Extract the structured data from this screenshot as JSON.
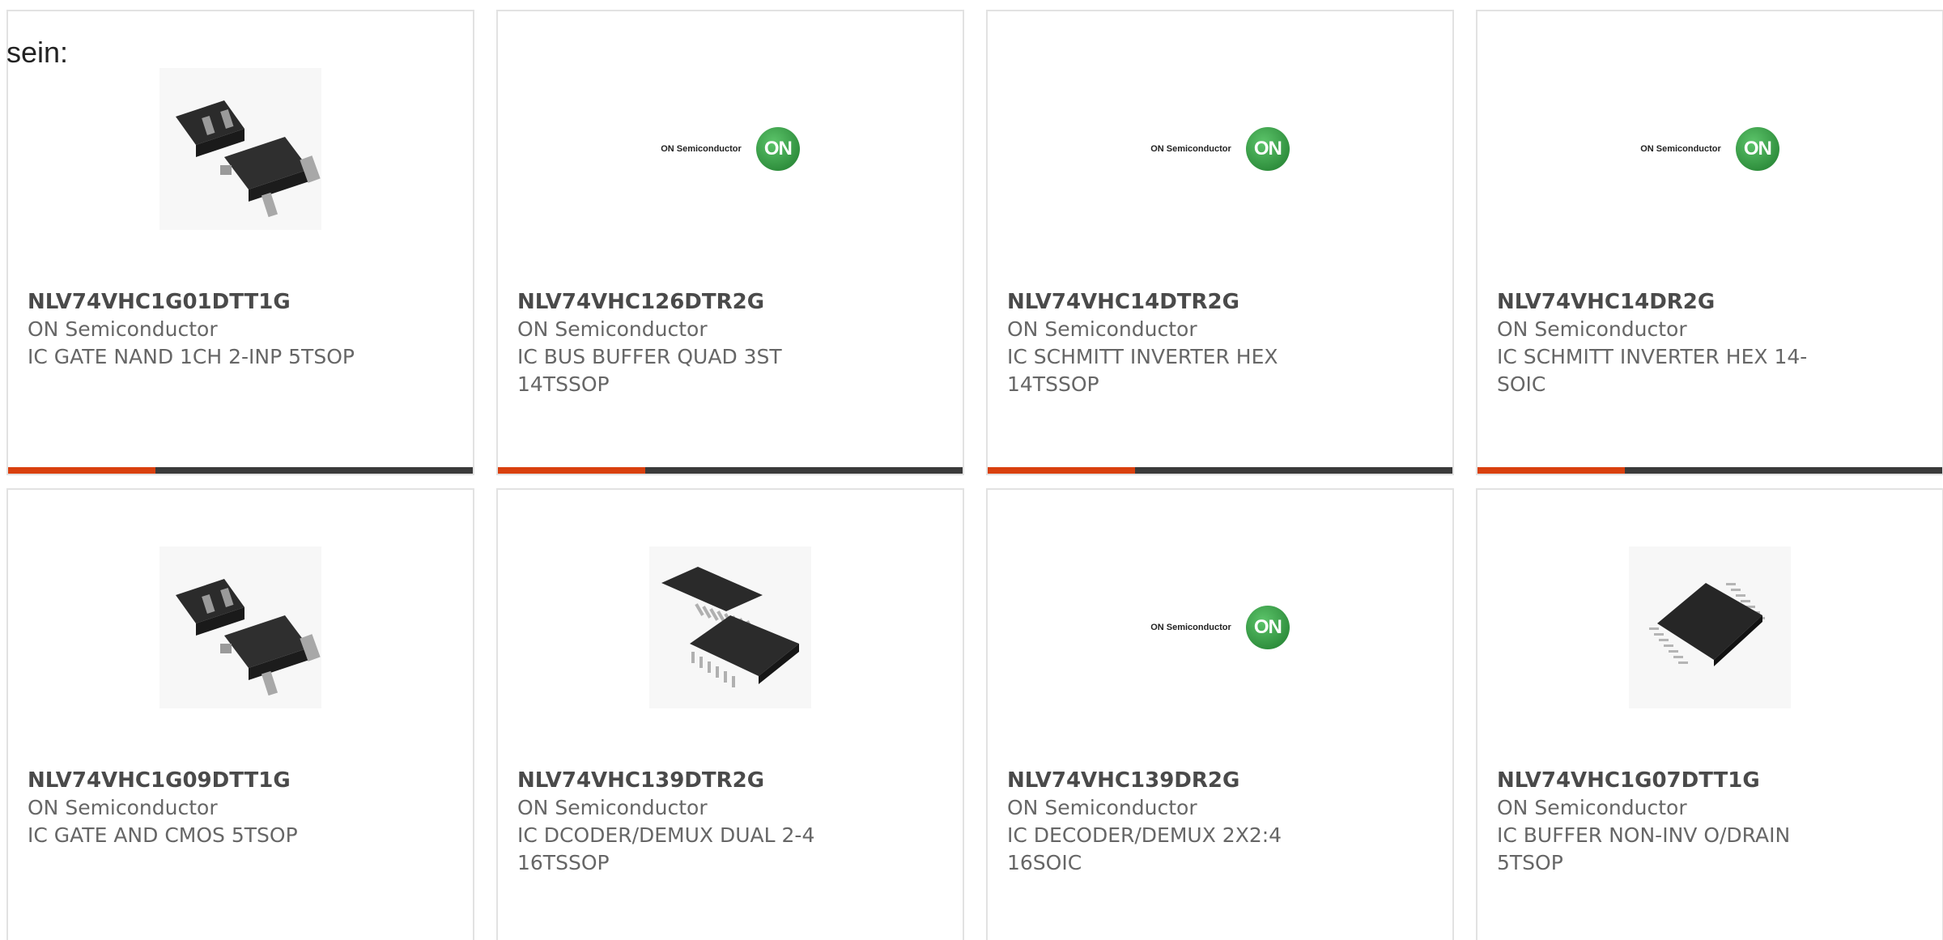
{
  "intro_text": "sein:",
  "colors": {
    "accent": "#d9400e",
    "bar": "#3a3a3a",
    "card_border": "#e2e2e2",
    "on_logo_green": "#2e8b3a"
  },
  "products": [
    {
      "part": "NLV74VHC1G01DTT1G",
      "manufacturer": "ON Semiconductor",
      "description": "IC GATE NAND 1CH 2-INP 5TSOP",
      "image": "sot-package-image",
      "show_bar": true
    },
    {
      "part": "NLV74VHC126DTR2G",
      "manufacturer": "ON Semiconductor",
      "description": "IC BUS BUFFER QUAD 3ST 14TSSOP",
      "image": "on-semiconductor-logo",
      "logo_text": "ON Semiconductor",
      "logo_mark": "ON",
      "show_bar": true
    },
    {
      "part": "NLV74VHC14DTR2G",
      "manufacturer": "ON Semiconductor",
      "description": "IC SCHMITT INVERTER HEX 14TSSOP",
      "image": "on-semiconductor-logo",
      "logo_text": "ON Semiconductor",
      "logo_mark": "ON",
      "show_bar": true
    },
    {
      "part": "NLV74VHC14DR2G",
      "manufacturer": "ON Semiconductor",
      "description": "IC SCHMITT INVERTER HEX 14-SOIC",
      "image": "on-semiconductor-logo",
      "logo_text": "ON Semiconductor",
      "logo_mark": "ON",
      "show_bar": true
    },
    {
      "part": "NLV74VHC1G09DTT1G",
      "manufacturer": "ON Semiconductor",
      "description": "IC GATE AND CMOS 5TSOP",
      "image": "sot-package-image",
      "show_bar": false
    },
    {
      "part": "NLV74VHC139DTR2G",
      "manufacturer": "ON Semiconductor",
      "description": "IC DCODER/DEMUX DUAL 2-4 16TSSOP",
      "image": "tssop-package-image",
      "show_bar": false
    },
    {
      "part": "NLV74VHC139DR2G",
      "manufacturer": "ON Semiconductor",
      "description": "IC DECODER/DEMUX 2X2:4 16SOIC",
      "image": "on-semiconductor-logo",
      "logo_text": "ON Semiconductor",
      "logo_mark": "ON",
      "show_bar": false
    },
    {
      "part": "NLV74VHC1G07DTT1G",
      "manufacturer": "ON Semiconductor",
      "description": "IC BUFFER NON-INV O/DRAIN 5TSOP",
      "image": "ssop-package-image",
      "show_bar": false
    }
  ]
}
